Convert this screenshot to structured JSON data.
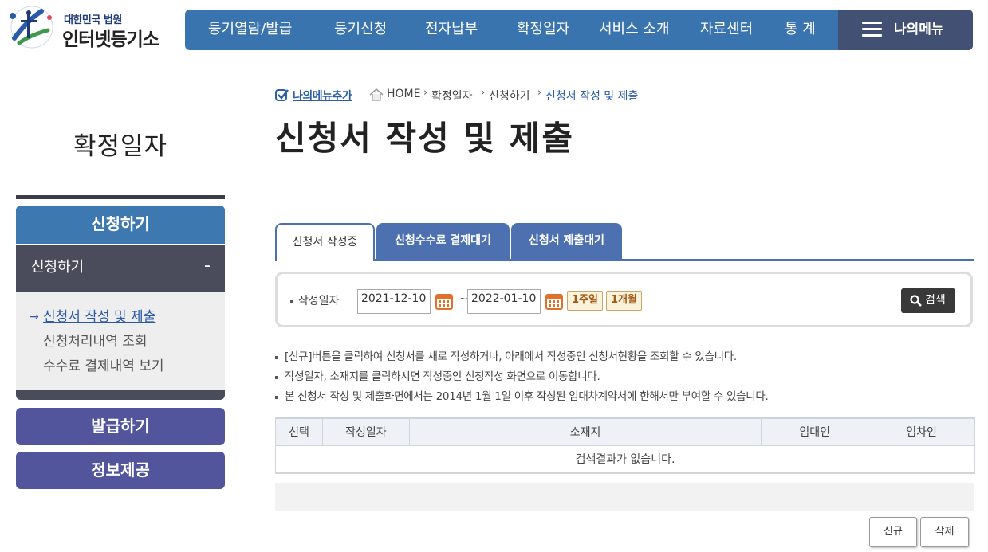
{
  "logo": {
    "sub": "대한민국 법원",
    "main": "인터넷등기소"
  },
  "gnb": {
    "items": [
      "등기열람/발급",
      "등기신청",
      "전자납부",
      "확정일자",
      "서비스 소개",
      "자료센터",
      "통 계"
    ],
    "my_menu": "나의메뉴"
  },
  "sidebar": {
    "title": "확정일자",
    "apply": "신청하기",
    "sub_head": "신청하기",
    "sub_toggle": "-",
    "sub_items": [
      "신청서 작성 및 제출",
      "신청처리내역 조회",
      "수수료 결제내역 보기"
    ],
    "issue": "발급하기",
    "info": "정보제공"
  },
  "breadcrumb": {
    "add_menu": "나의메뉴추가",
    "home": "HOME",
    "items": [
      "확정일자",
      "신청하기",
      "신청서 작성 및 제출"
    ]
  },
  "page_title": "신청서 작성 및 제출",
  "tabs": [
    "신청서 작성중",
    "신청수수료 결제대기",
    "신청서 제출대기"
  ],
  "search": {
    "label": "작성일자",
    "from": "2021-12-10",
    "to": "2022-01-10",
    "tilde": "~",
    "week_btn": "1주일",
    "month_btn": "1개월",
    "search_btn": "검색"
  },
  "notes": [
    "[신규]버튼을 클릭하여 신청서를 새로 작성하거나, 아래에서 작성중인 신청서현황을 조회할 수 있습니다.",
    "작성일자, 소재지를 클릭하시면 작성중인 신청작성 화면으로 이동합니다.",
    "본 신청서 작성 및 제출화면에서는 2014년 1월 1일 이후 작성된 임대차계약서에 한해서만 부여할 수 있습니다."
  ],
  "table": {
    "headers": [
      "선택",
      "작성일자",
      "소재지",
      "임대인",
      "임차인"
    ],
    "empty": "검색결과가 없습니다."
  },
  "buttons": {
    "new": "신규",
    "delete": "삭제"
  },
  "colors": {
    "primary": "#3a74ae",
    "sidebar_dark": "#4a4c5b",
    "sidebar_purple": "#53559c",
    "tab_blue": "#4d70b1"
  }
}
